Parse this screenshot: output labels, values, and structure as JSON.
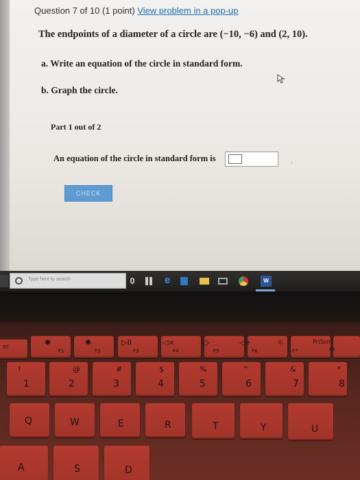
{
  "question": {
    "header": "Question 7 of 10 (1 point)",
    "popup_link": "View problem in a pop-up",
    "problem": "The endpoints of a diameter of a circle are (−10, −6) and (2, 10).",
    "part_a": "a. Write an equation of the circle in standard form.",
    "part_b": "b. Graph the circle.",
    "part_progress": "Part 1 out of 2",
    "answer_prompt": "An equation of the circle in standard form is",
    "check_button": "CHECK"
  },
  "taskbar": {
    "search_placeholder": "Type here to search",
    "icons": [
      "mic-icon",
      "task-view-icon",
      "edge-icon",
      "store-icon",
      "file-explorer-icon",
      "mail-icon",
      "chrome-icon",
      "firefox-icon",
      "word-icon"
    ],
    "word_label": "W"
  },
  "keyboard": {
    "fn_row": [
      "sc",
      "F1",
      "F2",
      "F3",
      "F4",
      "F5",
      "F6",
      "F7",
      "PrtScn"
    ],
    "fn_symbols": [
      "✱",
      "✱",
      "▷II",
      "◁×",
      "◁-",
      "◁+",
      "☼",
      "F8"
    ],
    "number_row": [
      {
        "top": "!",
        "main": "1"
      },
      {
        "top": "@",
        "main": "2"
      },
      {
        "top": "#",
        "main": "3"
      },
      {
        "top": "$",
        "main": "4"
      },
      {
        "top": "%",
        "main": "5"
      },
      {
        "top": "^",
        "main": "6"
      },
      {
        "top": "&",
        "main": "7"
      },
      {
        "top": "*",
        "main": "8"
      }
    ],
    "letter_row": [
      "Q",
      "W",
      "E",
      "R",
      "T",
      "Y",
      "U"
    ],
    "home_row": [
      "A",
      "S",
      "D"
    ]
  },
  "colors": {
    "link": "#1a6fb5",
    "check_button": "#5e9bd3",
    "key_red": "#b33a2e"
  }
}
